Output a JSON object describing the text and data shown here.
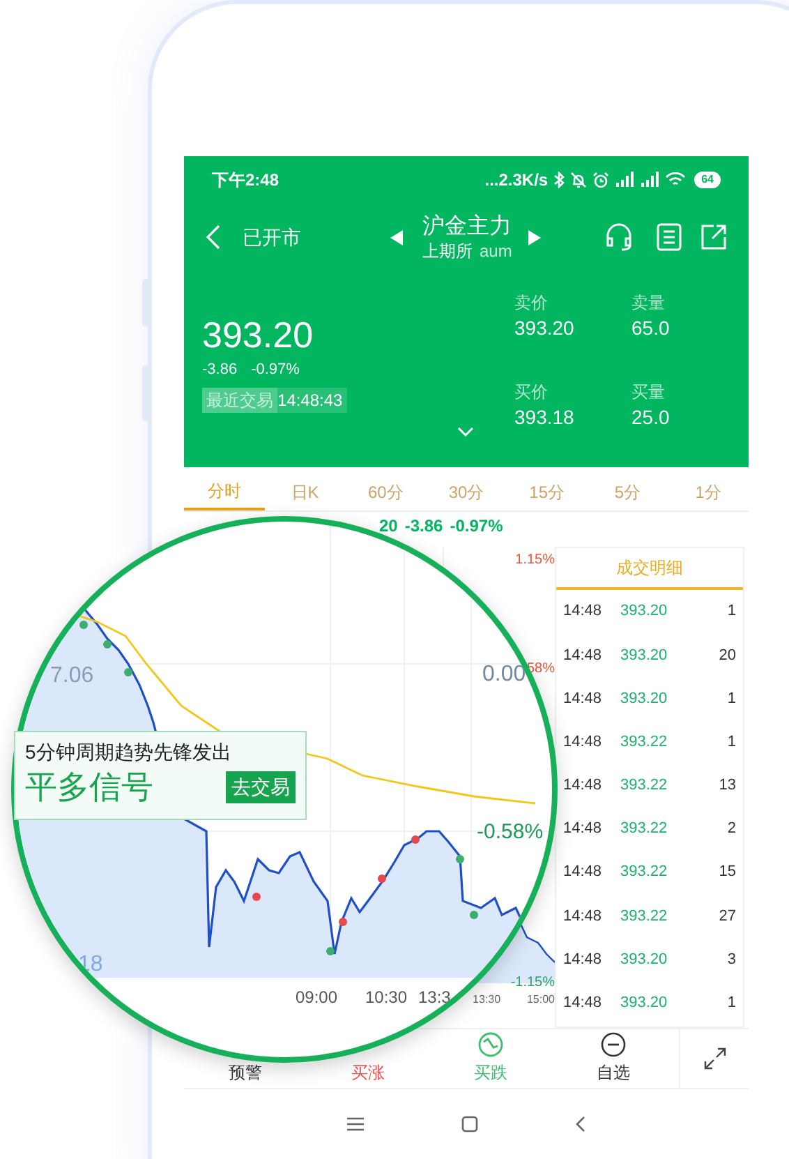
{
  "status_bar": {
    "time": "下午2:48",
    "speed": "...2.3K/s",
    "battery": "64"
  },
  "header": {
    "status": "已开市",
    "title": "沪金主力",
    "exchange": "上期所",
    "code": "aum"
  },
  "quote": {
    "price": "393.20",
    "change": "-3.86",
    "change_pct": "-0.97%",
    "last_trade_label": "最近交易",
    "last_trade_time": "14:48:43",
    "book": [
      {
        "label": "卖价",
        "value": "393.20"
      },
      {
        "label": "卖量",
        "value": "65.0"
      },
      {
        "label": "买价",
        "value": "393.18"
      },
      {
        "label": "买量",
        "value": "25.0"
      }
    ]
  },
  "tabs": [
    {
      "label": "分时",
      "selected": true
    },
    {
      "label": "日K",
      "selected": false
    },
    {
      "label": "60分",
      "selected": false
    },
    {
      "label": "30分",
      "selected": false
    },
    {
      "label": "15分",
      "selected": false
    },
    {
      "label": "5分",
      "selected": false
    },
    {
      "label": "1分",
      "selected": false
    }
  ],
  "chart_header": [
    "20",
    "-3.86",
    "-0.97%"
  ],
  "chart_labels": {
    "top_pct": "1.15%",
    "mid_pct": "58%",
    "bottom_pct": "-1.15%",
    "time_1": "13:30",
    "time_2": "15:00"
  },
  "trades": {
    "title": "成交明细",
    "rows": [
      {
        "time": "14:48",
        "price": "393.20",
        "volume": "1"
      },
      {
        "time": "14:48",
        "price": "393.20",
        "volume": "20"
      },
      {
        "time": "14:48",
        "price": "393.20",
        "volume": "1"
      },
      {
        "time": "14:48",
        "price": "393.22",
        "volume": "1"
      },
      {
        "time": "14:48",
        "price": "393.22",
        "volume": "13"
      },
      {
        "time": "14:48",
        "price": "393.22",
        "volume": "2"
      },
      {
        "time": "14:48",
        "price": "393.22",
        "volume": "15"
      },
      {
        "time": "14:48",
        "price": "393.22",
        "volume": "27"
      },
      {
        "time": "14:48",
        "price": "393.20",
        "volume": "3"
      },
      {
        "time": "14:48",
        "price": "393.20",
        "volume": "1"
      }
    ]
  },
  "toolbar": [
    {
      "label": "预警",
      "kind": "plain"
    },
    {
      "label": "买涨",
      "kind": "up"
    },
    {
      "label": "买跌",
      "kind": "down"
    },
    {
      "label": "自选",
      "kind": "watch"
    }
  ],
  "magnifier": {
    "left_value": "7.06",
    "mid_value": "0.00",
    "low_value": "18",
    "pct": "-0.58%",
    "times": [
      "09:00",
      "10:30",
      "13:3"
    ],
    "banner": {
      "subtitle": "5分钟周期趋势先锋发出",
      "title": "平多信号",
      "button": "去交易"
    }
  }
}
